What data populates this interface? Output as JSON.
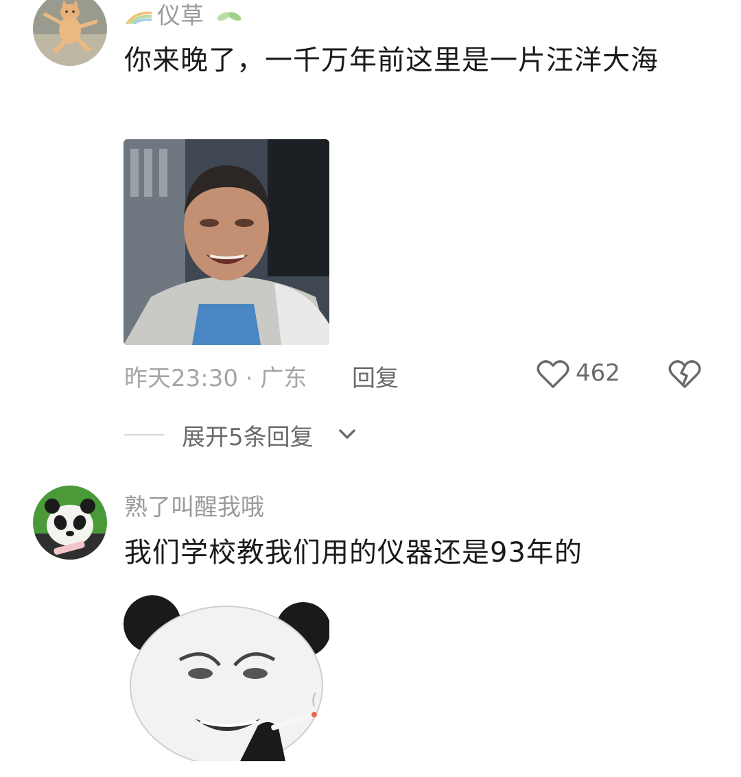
{
  "comments": [
    {
      "username": "仪草",
      "text": "你来晚了，一千万年前这里是一片汪洋大海",
      "time_location": "昨天23:30 · 广东",
      "reply_label": "回复",
      "like_count": "462",
      "expand_label": "展开5条回复",
      "avatar_icon": "cat-avatar-icon",
      "sticker_icon": "crying-man-sticker"
    },
    {
      "username": "熟了叫醒我哦",
      "text": "我们学校教我们用的仪器还是93年的",
      "avatar_icon": "panda-avatar-icon",
      "sticker_icon": "panda-face-sticker"
    }
  ],
  "colors": {
    "username": "#9a9a9a",
    "text": "#1a1a1a",
    "meta": "#a5a5a5",
    "action": "#6a6a6a"
  }
}
